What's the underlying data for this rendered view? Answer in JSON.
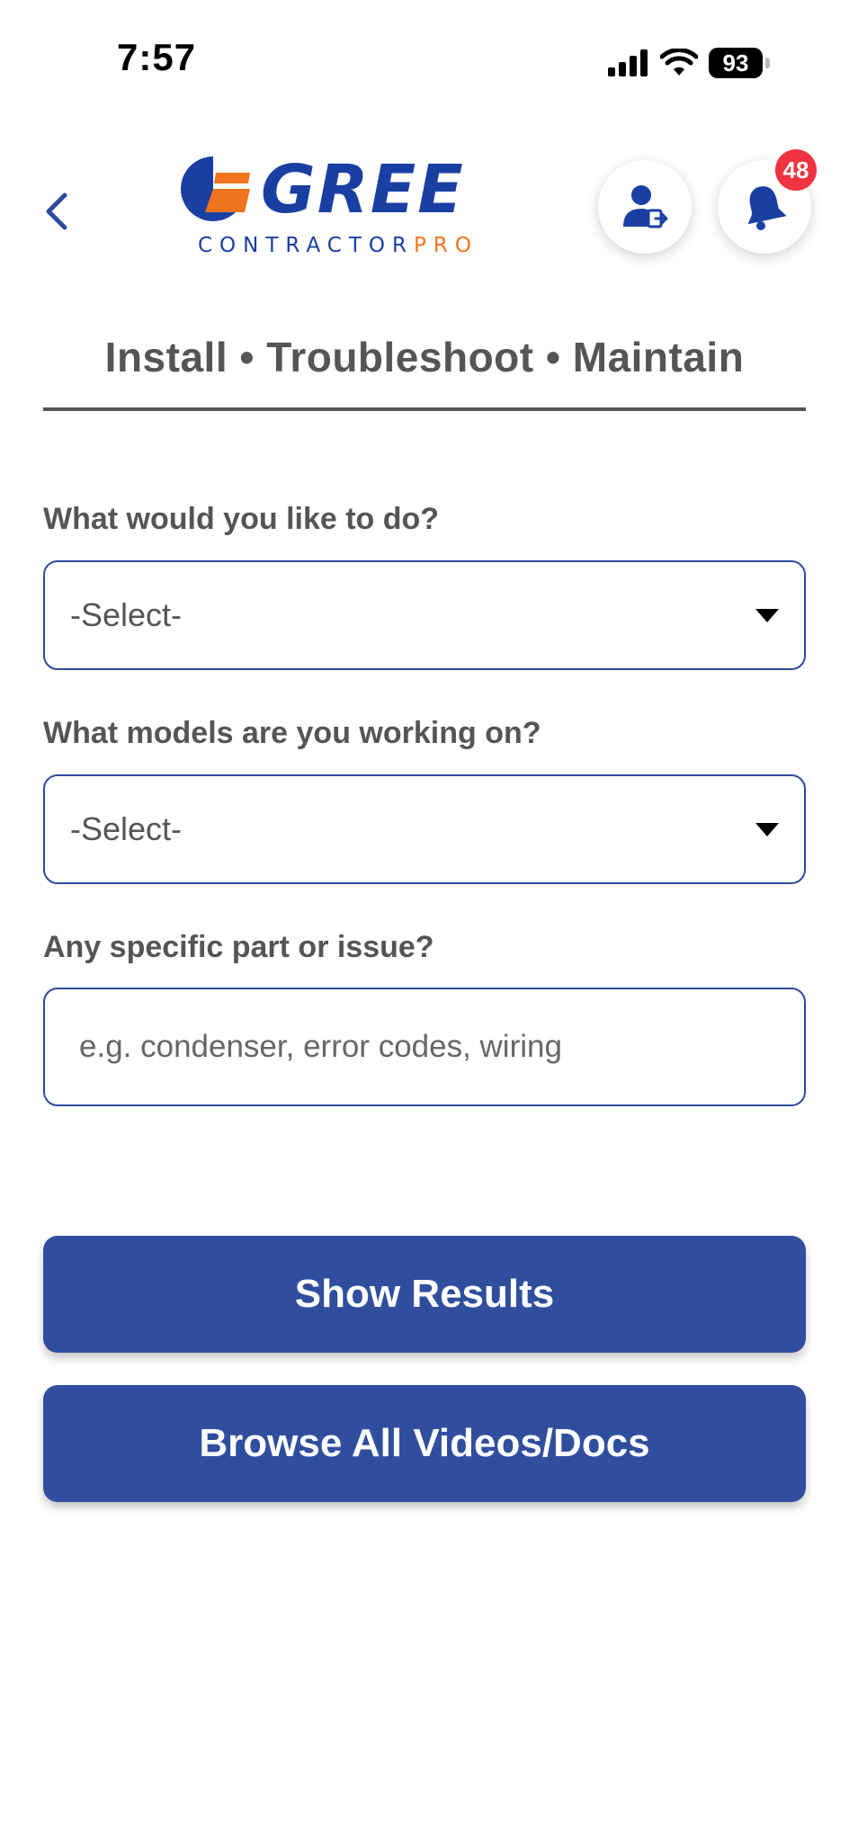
{
  "status_bar": {
    "time": "7:57",
    "battery_level": "93",
    "icons": [
      "cellular-signal-icon",
      "wifi-icon",
      "battery-icon"
    ]
  },
  "header": {
    "back_icon": "chevron-left-icon",
    "logo": {
      "word": "GREE",
      "sub_a": "CONTRACTOR",
      "sub_b": "PRO"
    },
    "account_icon": "user-logout-icon",
    "notifications_icon": "bell-icon",
    "notification_count": "48"
  },
  "tagline": "Install • Troubleshoot • Maintain",
  "form": {
    "action": {
      "label": "What would you like to do?",
      "value": "-Select-"
    },
    "models": {
      "label": "What models are you working on?",
      "value": "-Select-"
    },
    "issue": {
      "label": "Any specific part or issue?",
      "placeholder": "e.g. condenser, error codes, wiring",
      "value": ""
    }
  },
  "buttons": {
    "show_results": "Show Results",
    "browse_all": "Browse All Videos/Docs"
  },
  "colors": {
    "brand_blue": "#2f4f9e",
    "logo_blue": "#1a3fa3",
    "logo_orange": "#f0741e",
    "badge_red": "#ef3340",
    "text_gray": "#555555"
  }
}
